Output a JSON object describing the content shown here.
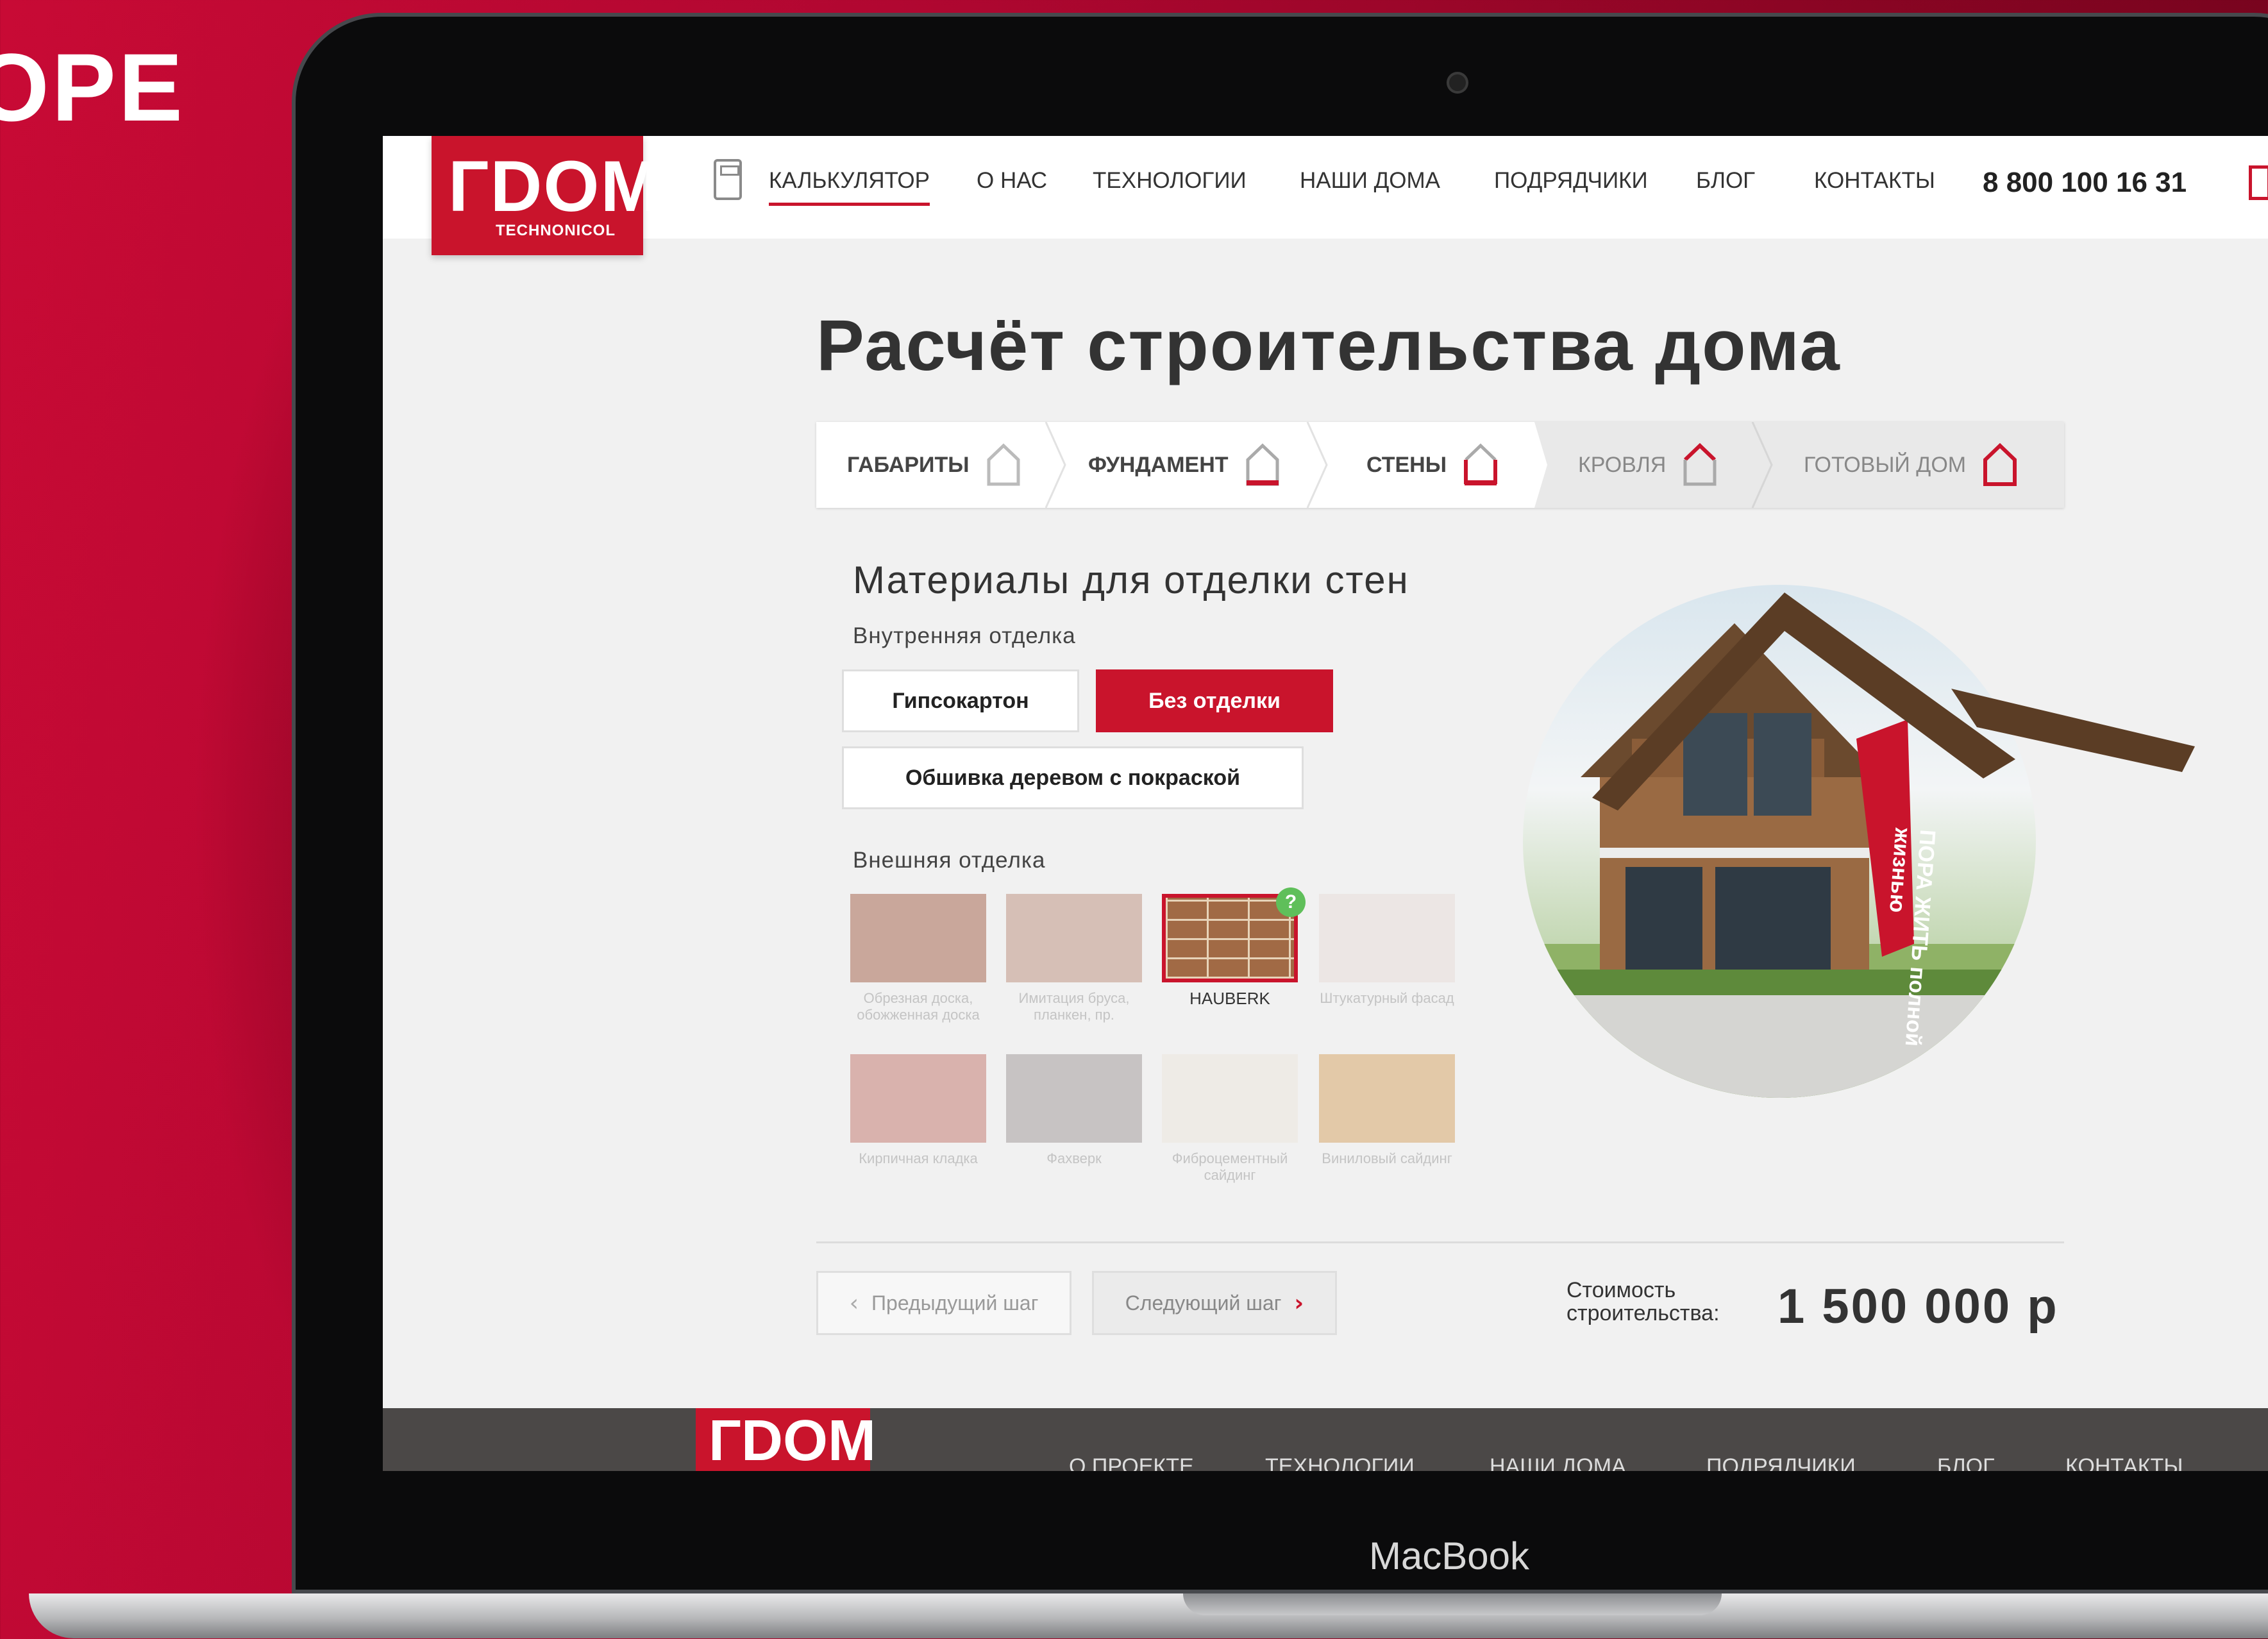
{
  "bg_word": "ОРЕ",
  "device_label": "MacBook",
  "header": {
    "logo_mark": "ГDOM",
    "logo_sub": "TECHNONICOL",
    "nav": [
      "КАЛЬКУЛЯТОР",
      "О НАС",
      "ТЕХНОЛОГИИ",
      "НАШИ ДОМА",
      "ПОДРЯДЧИКИ",
      "БЛОГ",
      "КОНТАКТЫ"
    ],
    "phone": "8 800 100 16 31"
  },
  "page_title": "Расчёт строительства дома",
  "steps": [
    "ГАБАРИТЫ",
    "ФУНДАМЕНТ",
    "СТЕНЫ",
    "КРОВЛЯ",
    "ГОТОВЫЙ ДОМ"
  ],
  "section_title": "Материалы для  отделки стен",
  "interior": {
    "label": "Внутренняя отделка",
    "options": [
      "Гипсокартон",
      "Без отделки",
      "Обшивка деревом с покраской"
    ],
    "selected": "Без отделки"
  },
  "exterior": {
    "label": "Внешняя отделка",
    "tiles": [
      {
        "caption": "Обрезная доска, обожженная доска",
        "color": "#c9a79b"
      },
      {
        "caption": "Имитация бруса, планкен, пр.",
        "color": "#d6bfb6"
      },
      {
        "caption": "HAUBERK",
        "color": "#a16a45",
        "selected": true
      },
      {
        "caption": "Штукатурный фасад",
        "color": "#ece6e4"
      },
      {
        "caption": "Кирпичная кладка",
        "color": "#d9b2ad"
      },
      {
        "caption": "Фахверк",
        "color": "#c7c3c3"
      },
      {
        "caption": "Фиброцементный сайдинг",
        "color": "#eeebe6"
      },
      {
        "caption": "Виниловый сайдинг",
        "color": "#e3c9a8"
      }
    ],
    "help_badge": "?"
  },
  "photo_flag_text": "ПОРА ЖИТЬ полной жизнью",
  "pager": {
    "prev": "Предыдущий шаг",
    "next": "Следующий шаг"
  },
  "cost": {
    "label": "Стоимость строительства:",
    "value": "1 500 000 р"
  },
  "footer": {
    "logo": "ГDOM",
    "nav": [
      "О ПРОЕКТЕ",
      "ТЕХНОЛОГИИ",
      "НАШИ ДОМА",
      "ПОДРЯДЧИКИ",
      "БЛОГ",
      "КОНТАКТЫ"
    ]
  },
  "colors": {
    "brand_red": "#c9142c",
    "step_grey": "#e9e9e9",
    "footer": "#4b4847"
  }
}
